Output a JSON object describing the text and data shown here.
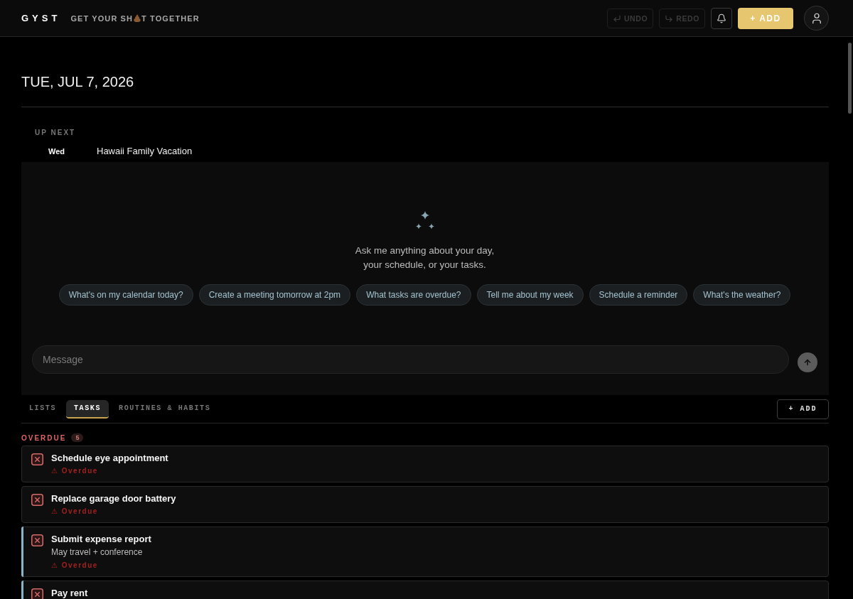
{
  "header": {
    "logo": "GYST",
    "tagline": {
      "start": "GET YOUR SH",
      "end": "T TOGETHER"
    },
    "undo": {
      "label": "UNDO",
      "disabled": true
    },
    "redo": {
      "label": "REDO",
      "disabled": true
    },
    "add_button": "+ ADD"
  },
  "date": "TUE, JUL 7, 2026",
  "up_next": {
    "title": "UP NEXT",
    "events": [
      {
        "day": "Wed",
        "title": "Hawaii Family Vacation"
      }
    ]
  },
  "assistant": {
    "prompt": "Ask me anything about your day,\nyour schedule, or your tasks.",
    "suggestions": [
      "What's on my calendar today?",
      "Create a meeting tomorrow at 2pm",
      "What tasks are overdue?",
      "Tell me about my week",
      "Schedule a reminder",
      "What's the weather?"
    ],
    "message": {
      "placeholder": "Message"
    }
  },
  "tab_bar": {
    "tabs": [
      {
        "label": "LISTS",
        "selected": false
      },
      {
        "label": "TASKS",
        "selected": true
      },
      {
        "label": "ROUTINES & HABITS",
        "selected": false
      }
    ],
    "add_button": "+ ADD"
  },
  "sections": [
    {
      "kind": "overdue",
      "title": "OVERDUE",
      "count": "5",
      "tasks": [
        {
          "title": "Schedule eye appointment",
          "status": "⚠ Overdue",
          "checked": false
        },
        {
          "title": "Replace garage door battery",
          "status": "⚠ Overdue",
          "checked": false
        },
        {
          "title": "Submit expense report",
          "note": "May travel + conference",
          "status": "⚠ Overdue",
          "checked": false,
          "color": "#8db3c9"
        },
        {
          "title": "Pay rent",
          "checked": false,
          "color": "#8db3c9"
        }
      ]
    }
  ]
}
